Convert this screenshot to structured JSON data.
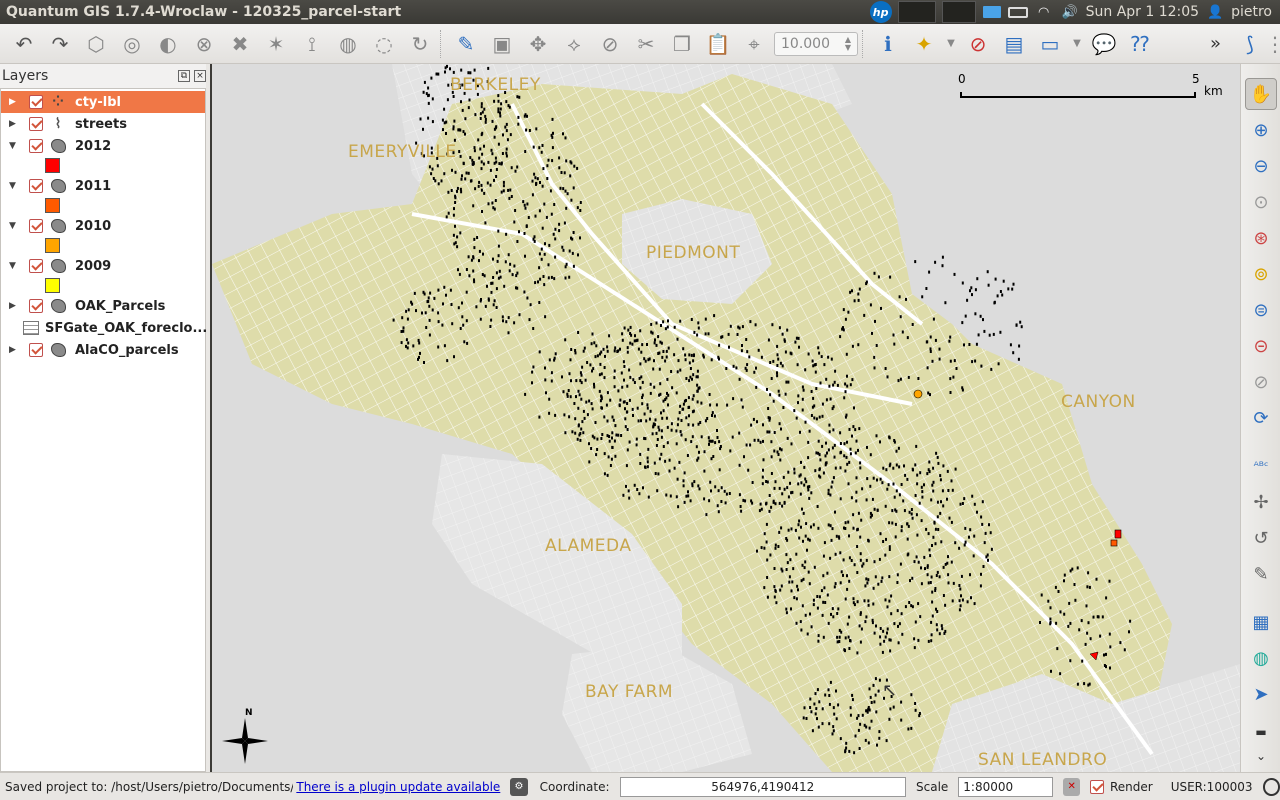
{
  "window": {
    "title": "Quantum GIS 1.7.4-Wroclaw - 120325_parcel-start",
    "clock": "Sun Apr  1 12:05",
    "user": "pietro",
    "hp_label": "hp"
  },
  "toolbar": {
    "scale_value": "10.000",
    "overflow": "»"
  },
  "layers_panel": {
    "title": "Layers",
    "layers": [
      {
        "name": "cty-lbl",
        "expanded": false,
        "checked": true,
        "type": "point",
        "selected": true
      },
      {
        "name": "streets",
        "expanded": false,
        "checked": true,
        "type": "line",
        "selected": false
      },
      {
        "name": "2012",
        "expanded": true,
        "checked": true,
        "type": "polygon",
        "swatch": "#ff0000"
      },
      {
        "name": "2011",
        "expanded": true,
        "checked": true,
        "type": "polygon",
        "swatch": "#ff5a00"
      },
      {
        "name": "2010",
        "expanded": true,
        "checked": true,
        "type": "polygon",
        "swatch": "#ffa500"
      },
      {
        "name": "2009",
        "expanded": true,
        "checked": true,
        "type": "polygon",
        "swatch": "#ffff00"
      },
      {
        "name": "OAK_Parcels",
        "expanded": false,
        "checked": true,
        "type": "polygon"
      },
      {
        "name": "SFGate_OAK_foreclo...",
        "expanded": false,
        "checked": false,
        "type": "table"
      },
      {
        "name": "AlaCO_parcels",
        "expanded": false,
        "checked": true,
        "type": "polygon"
      }
    ]
  },
  "map": {
    "labels": [
      "BERKELEY",
      "EMERYVILLE",
      "PIEDMONT",
      "CANYON",
      "ALAMEDA",
      "BAY FARM",
      "SAN LEANDRO"
    ],
    "scalebar": {
      "start": "0",
      "end": "5",
      "unit": "km"
    },
    "north_label": "N",
    "colors": {
      "land": "#dedcaa",
      "water": "#dcdcdc",
      "streets": "#ffffff",
      "parcels": "#000000",
      "label": "#c8a64b"
    }
  },
  "statusbar": {
    "message": "Saved project to: /host/Users/pietro/Documents/geog/oa",
    "plugin_update": "There is a plugin update available",
    "coordinate_label": "Coordinate:",
    "coordinate_value": "564976,4190412",
    "scale_label": "Scale",
    "scale_value": "1:80000",
    "render_label": "Render",
    "user_label": "USER:100003"
  }
}
